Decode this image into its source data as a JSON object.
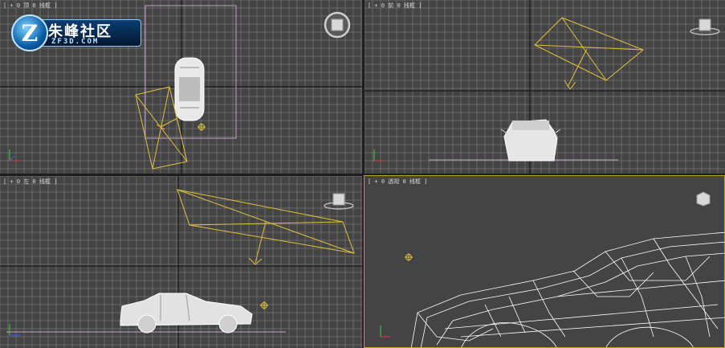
{
  "viewports": {
    "top": {
      "label": "[ + 0 顶 0 线框 ]"
    },
    "front": {
      "label": "[ + 0 前 0 线框 ]"
    },
    "left": {
      "label": "[ + 0 左 0 线框 ]"
    },
    "persp": {
      "label": "[ + 0 透视 0 线框 ]"
    }
  },
  "logo": {
    "chinese": "朱峰社区",
    "english": "ZF3D.COM",
    "badge_letter": "Z"
  },
  "colors": {
    "viewport_bg": "#444444",
    "grid": "#8a8a8a",
    "grid_major": "#1a1a1a",
    "camera": "#e0c040",
    "active_border": "#c8a020",
    "selection": "#c89ec8",
    "car_wire": "#ffffff"
  },
  "icons": [
    "viewcube-icon",
    "axis-tripod-icon",
    "camera-target-icon",
    "logo-icon"
  ]
}
